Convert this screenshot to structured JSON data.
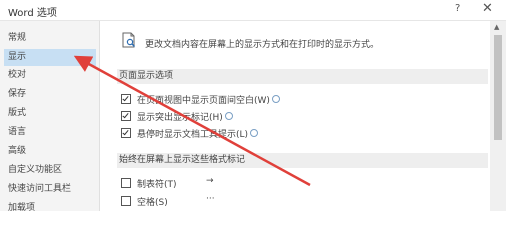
{
  "window": {
    "title": "Word 选项",
    "help": "?",
    "close": "✕"
  },
  "sidebar": {
    "items": [
      {
        "label": "常规"
      },
      {
        "label": "显示"
      },
      {
        "label": "校对"
      },
      {
        "label": "保存"
      },
      {
        "label": "版式"
      },
      {
        "label": "语言"
      },
      {
        "label": "高级"
      },
      {
        "label": "自定义功能区"
      },
      {
        "label": "快速访问工具栏"
      },
      {
        "label": "加载项"
      }
    ],
    "selected": "显示"
  },
  "main": {
    "description": "更改文档内容在屏幕上的显示方式和在打印时的显示方式。",
    "page_display": {
      "header": "页面显示选项",
      "options": [
        {
          "label": "在页面视图中显示页面间空白(W)",
          "checked": true
        },
        {
          "label": "显示突出显示标记(H)",
          "checked": true
        },
        {
          "label": "悬停时显示文档工具提示(L)",
          "checked": true
        }
      ]
    },
    "format_marks": {
      "header": "始终在屏幕上显示这些格式标记",
      "options": [
        {
          "label": "制表符(T)",
          "checked": false,
          "symbol": "→"
        },
        {
          "label": "空格(S)",
          "checked": false,
          "symbol": "···"
        }
      ]
    }
  },
  "colors": {
    "selected_nav": "#c7dff3",
    "arrow": "#e0403a"
  }
}
